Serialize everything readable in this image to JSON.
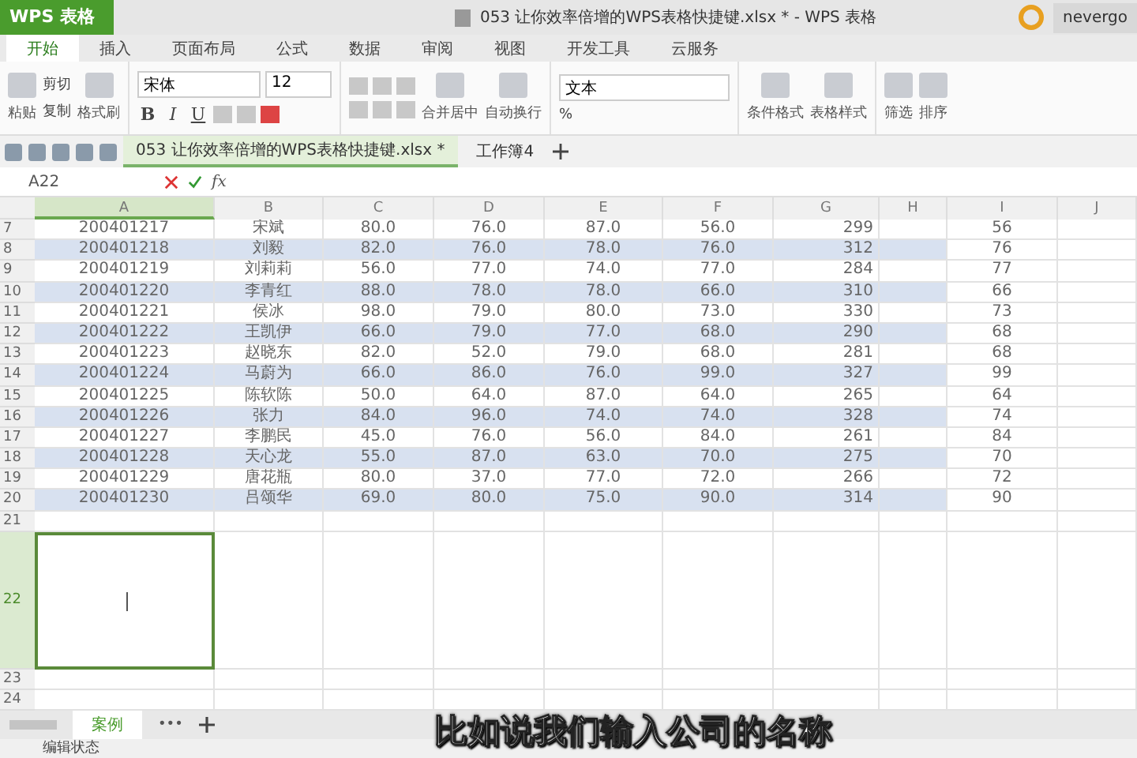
{
  "app_button": "WPS 表格",
  "title": "053 让你效率倍增的WPS表格快捷键.xlsx * - WPS 表格",
  "user": "nevergo",
  "menu_tabs": [
    {
      "label": "开始",
      "selected": true
    },
    {
      "label": "插入",
      "selected": false
    },
    {
      "label": "页面布局",
      "selected": false
    },
    {
      "label": "公式",
      "selected": false
    },
    {
      "label": "数据",
      "selected": false
    },
    {
      "label": "审阅",
      "selected": false
    },
    {
      "label": "视图",
      "selected": false
    },
    {
      "label": "开发工具",
      "selected": false
    },
    {
      "label": "云服务",
      "selected": false
    }
  ],
  "ribbon": {
    "paste": "粘贴",
    "cut": "剪切",
    "copy": "复制",
    "format_painter": "格式刷",
    "font_name": "宋体",
    "font_size": "12",
    "bold": "B",
    "italic": "I",
    "underline": "U",
    "merge": "合并居中",
    "wrap": "自动换行",
    "number_format": "文本",
    "percent": "%",
    "conditional": "条件格式",
    "table_style": "表格样式",
    "filter": "筛选",
    "sort": "排序"
  },
  "doc_tabs": [
    {
      "label": "053 让你效率倍增的WPS表格快捷键.xlsx *",
      "selected": true
    },
    {
      "label": "工作簿4",
      "selected": false
    }
  ],
  "formula_bar": {
    "cell_ref": "A22",
    "fx": "fx"
  },
  "columns": [
    {
      "label": "A",
      "selected": true
    },
    {
      "label": "B",
      "selected": false
    },
    {
      "label": "C",
      "selected": false
    },
    {
      "label": "D",
      "selected": false
    },
    {
      "label": "E",
      "selected": false
    },
    {
      "label": "F",
      "selected": false
    },
    {
      "label": "G",
      "selected": false
    },
    {
      "label": "H",
      "selected": false
    },
    {
      "label": "I",
      "selected": false
    },
    {
      "label": "J",
      "selected": false
    }
  ],
  "rows": [
    {
      "number": "7",
      "banded": false,
      "cells": [
        "200401217",
        "宋斌",
        "80.0",
        "76.0",
        "87.0",
        "56.0",
        "299",
        "",
        "56",
        ""
      ]
    },
    {
      "number": "8",
      "banded": true,
      "cells": [
        "200401218",
        "刘毅",
        "82.0",
        "76.0",
        "78.0",
        "76.0",
        "312",
        "",
        "76",
        ""
      ]
    },
    {
      "number": "9",
      "banded": false,
      "cells": [
        "200401219",
        "刘莉莉",
        "56.0",
        "77.0",
        "74.0",
        "77.0",
        "284",
        "",
        "77",
        ""
      ]
    },
    {
      "number": "10",
      "banded": true,
      "cells": [
        "200401220",
        "李青红",
        "88.0",
        "78.0",
        "78.0",
        "66.0",
        "310",
        "",
        "66",
        ""
      ]
    },
    {
      "number": "11",
      "banded": false,
      "cells": [
        "200401221",
        "侯冰",
        "98.0",
        "79.0",
        "80.0",
        "73.0",
        "330",
        "",
        "73",
        ""
      ]
    },
    {
      "number": "12",
      "banded": true,
      "cells": [
        "200401222",
        "王凯伊",
        "66.0",
        "79.0",
        "77.0",
        "68.0",
        "290",
        "",
        "68",
        ""
      ]
    },
    {
      "number": "13",
      "banded": false,
      "cells": [
        "200401223",
        "赵晓东",
        "82.0",
        "52.0",
        "79.0",
        "68.0",
        "281",
        "",
        "68",
        ""
      ]
    },
    {
      "number": "14",
      "banded": true,
      "cells": [
        "200401224",
        "马蔚为",
        "66.0",
        "86.0",
        "76.0",
        "99.0",
        "327",
        "",
        "99",
        ""
      ]
    },
    {
      "number": "15",
      "banded": false,
      "cells": [
        "200401225",
        "陈软陈",
        "50.0",
        "64.0",
        "87.0",
        "64.0",
        "265",
        "",
        "64",
        ""
      ]
    },
    {
      "number": "16",
      "banded": true,
      "cells": [
        "200401226",
        "张力",
        "84.0",
        "96.0",
        "74.0",
        "74.0",
        "328",
        "",
        "74",
        ""
      ]
    },
    {
      "number": "17",
      "banded": false,
      "cells": [
        "200401227",
        "李鹏民",
        "45.0",
        "76.0",
        "56.0",
        "84.0",
        "261",
        "",
        "84",
        ""
      ]
    },
    {
      "number": "18",
      "banded": true,
      "cells": [
        "200401228",
        "天心龙",
        "55.0",
        "87.0",
        "63.0",
        "70.0",
        "275",
        "",
        "70",
        ""
      ]
    },
    {
      "number": "19",
      "banded": false,
      "cells": [
        "200401229",
        "唐花瓶",
        "80.0",
        "37.0",
        "77.0",
        "72.0",
        "266",
        "",
        "72",
        ""
      ]
    },
    {
      "number": "20",
      "banded": true,
      "cells": [
        "200401230",
        "吕颂华",
        "69.0",
        "80.0",
        "75.0",
        "90.0",
        "314",
        "",
        "90",
        ""
      ]
    },
    {
      "number": "21",
      "banded": false,
      "cells": [
        "",
        "",
        "",
        "",
        "",
        "",
        "",
        "",
        "",
        ""
      ]
    }
  ],
  "active_row": {
    "number": "22",
    "selected": true
  },
  "after_rows": [
    "23",
    "24"
  ],
  "sheet_tabs": [
    {
      "label": "案例",
      "selected": true
    }
  ],
  "sheet_more": "•••",
  "status": "编辑状态",
  "subtitle": "比如说我们输入公司的名称"
}
